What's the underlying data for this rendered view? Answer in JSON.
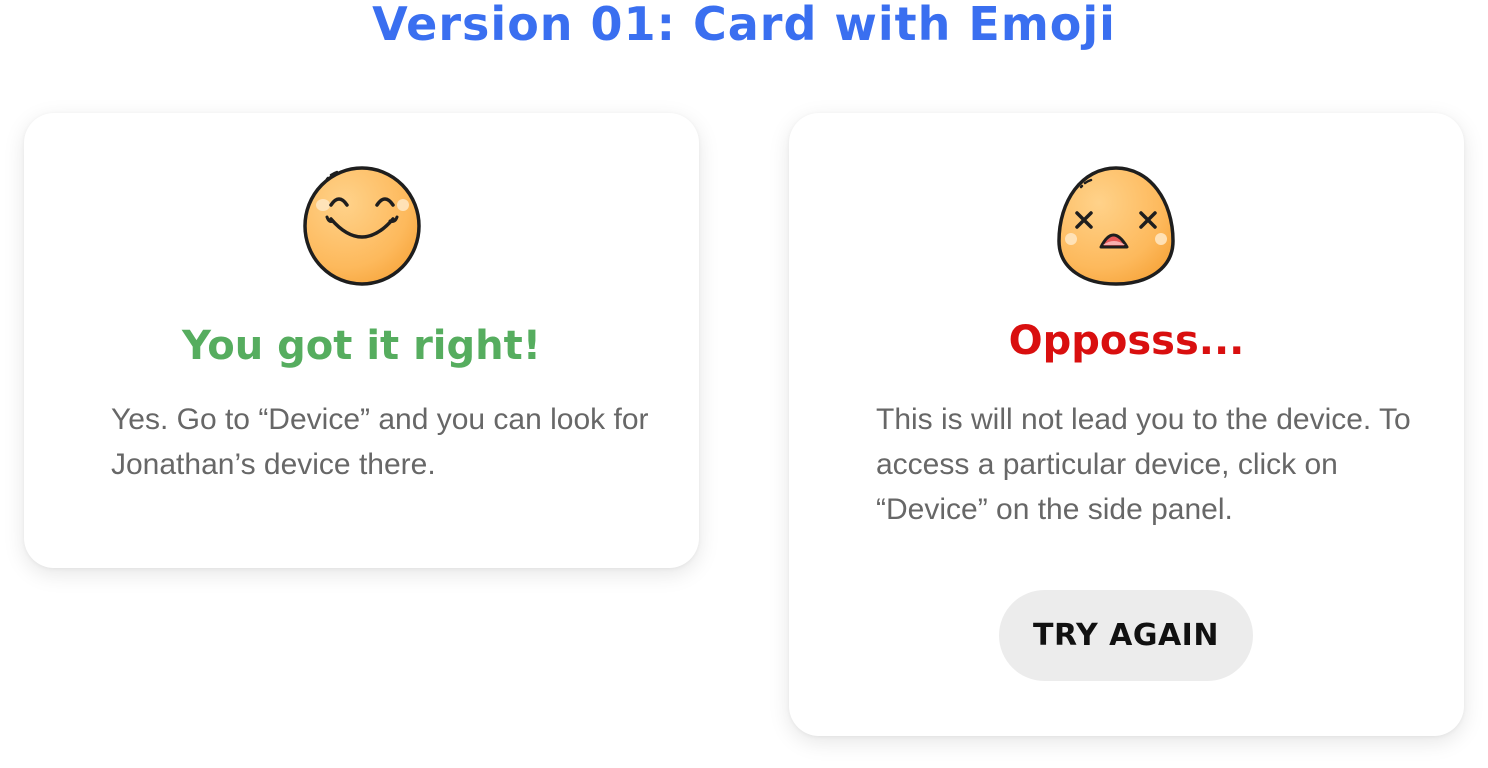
{
  "page": {
    "title": "Version 01: Card with Emoji"
  },
  "cards": {
    "success": {
      "emoji": "smiling-face-icon",
      "heading": "You got it right!",
      "body": "Yes. Go to “Device” and you can look for Jonathan’s device there.",
      "heading_color": "#56ad5f"
    },
    "error": {
      "emoji": "dizzy-face-icon",
      "heading": "Opposss...",
      "body": "This is will not lead you to the device. To access a particular device, click on “Device” on the side panel.",
      "heading_color": "#d90f0f",
      "button_label": "TRY AGAIN"
    }
  },
  "colors": {
    "title": "#3a6ff0",
    "body_text": "#676767",
    "button_bg": "#ececec",
    "emoji_fill": "#fdb95c",
    "emoji_outline": "#1e1e1e"
  }
}
